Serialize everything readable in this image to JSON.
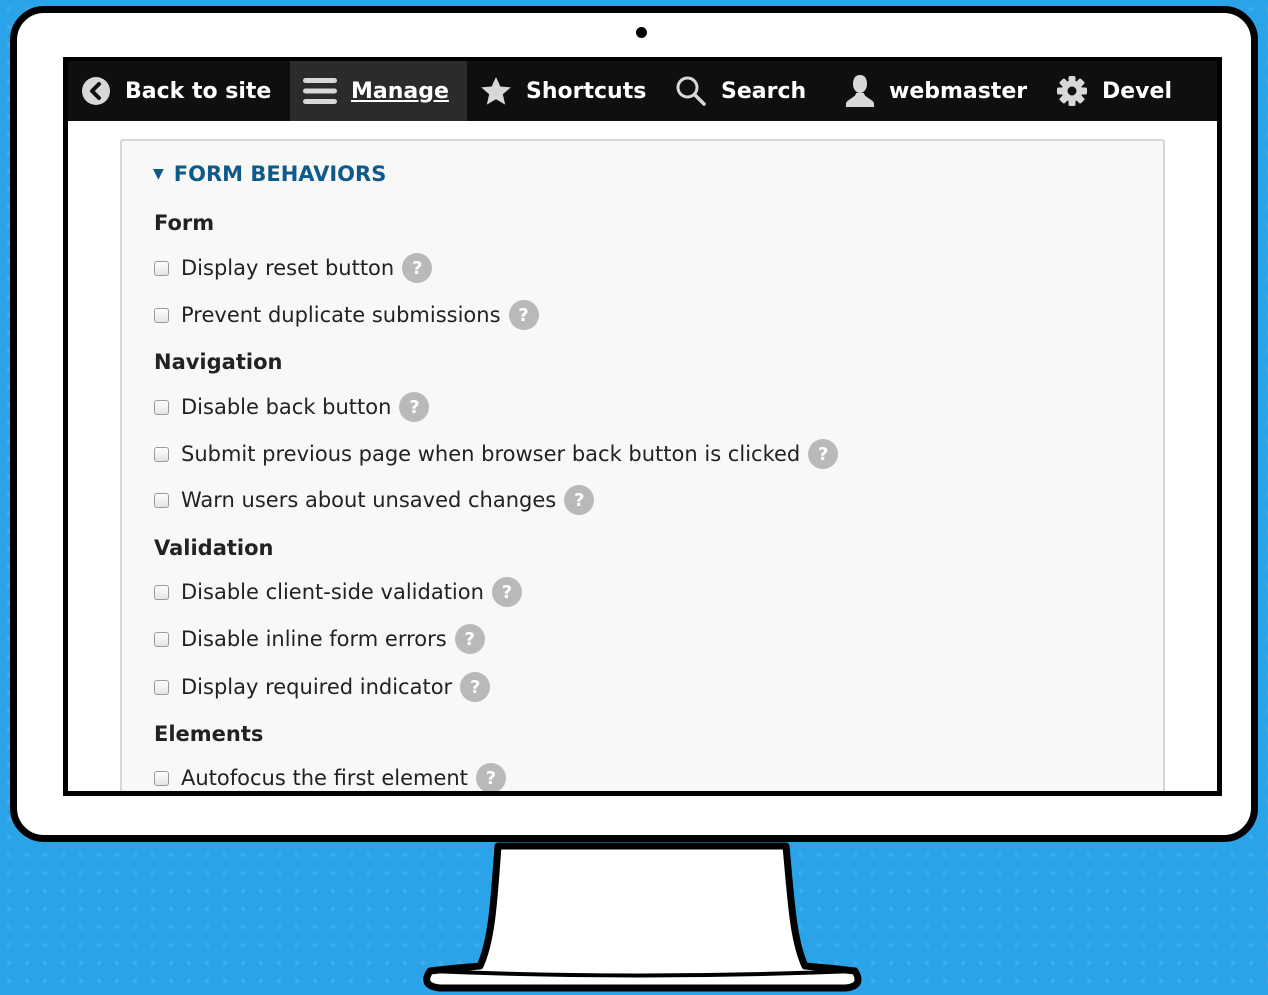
{
  "toolbar": {
    "items": [
      {
        "label": "Back to site",
        "icon": "back-chevron-icon"
      },
      {
        "label": "Manage",
        "icon": "hamburger-menu-icon"
      },
      {
        "label": "Shortcuts",
        "icon": "star-icon"
      },
      {
        "label": "Search",
        "icon": "search-icon"
      },
      {
        "label": "webmaster",
        "icon": "user-icon"
      },
      {
        "label": "Devel",
        "icon": "gear-icon"
      }
    ]
  },
  "form_behaviors": {
    "summary": "FORM BEHAVIORS",
    "caret": "▼",
    "help_glyph": "?",
    "sections": [
      {
        "heading": "Form",
        "options": [
          "Display reset button",
          "Prevent duplicate submissions"
        ]
      },
      {
        "heading": "Navigation",
        "options": [
          "Disable back button",
          "Submit previous page when browser back button is clicked",
          "Warn users about unsaved changes"
        ]
      },
      {
        "heading": "Validation",
        "options": [
          "Disable client-side validation",
          "Disable inline form errors",
          "Display required indicator"
        ]
      },
      {
        "heading": "Elements",
        "options": [
          "Autofocus the first element"
        ]
      }
    ]
  },
  "colors": {
    "background": "#2aa3e8",
    "toolbar": "#0f0f0f",
    "toolbar_active": "#2b2b2b",
    "summary_link": "#0e5a8a",
    "help_badge": "#b9b9b9"
  }
}
